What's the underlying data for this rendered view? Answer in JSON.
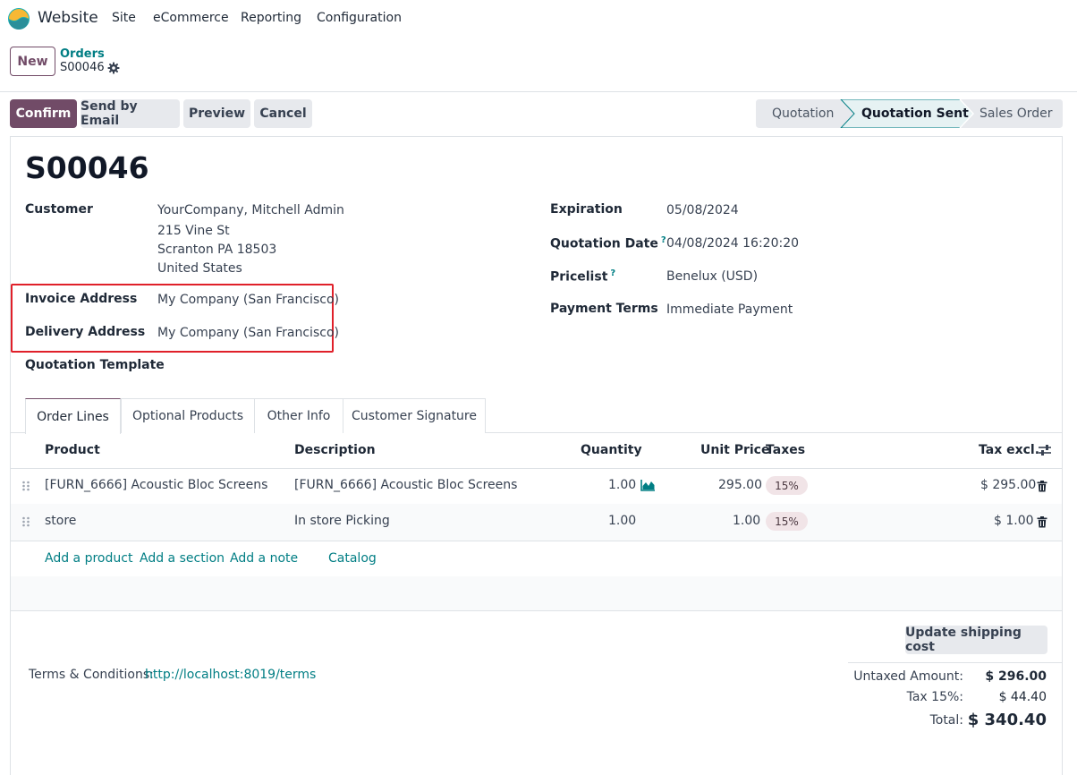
{
  "app": {
    "name": "Website",
    "menu": [
      "Site",
      "eCommerce",
      "Reporting",
      "Configuration"
    ]
  },
  "control": {
    "new_label": "New",
    "breadcrumb_parent": "Orders",
    "breadcrumb_current": "S00046"
  },
  "actions": {
    "confirm": "Confirm",
    "send_email": "Send by Email",
    "preview": "Preview",
    "cancel": "Cancel"
  },
  "status": {
    "steps": [
      "Quotation",
      "Quotation Sent",
      "Sales Order"
    ],
    "active": "Quotation Sent"
  },
  "form": {
    "name": "S00046",
    "customer_label": "Customer",
    "customer_lines": [
      "YourCompany, Mitchell Admin",
      "215 Vine St",
      "Scranton PA 18503",
      "United States"
    ],
    "invoice_label": "Invoice Address",
    "invoice_value": "My Company (San Francisco)",
    "delivery_label": "Delivery Address",
    "delivery_value": "My Company (San Francisco)",
    "template_label": "Quotation Template",
    "expiration_label": "Expiration",
    "expiration_value": "05/08/2024",
    "qdate_label": "Quotation Date",
    "qdate_value": "04/08/2024 16:20:20",
    "pricelist_label": "Pricelist",
    "pricelist_value": "Benelux (USD)",
    "terms_label": "Payment Terms",
    "terms_value": "Immediate Payment",
    "help_mark": "?"
  },
  "tabs": [
    "Order Lines",
    "Optional Products",
    "Other Info",
    "Customer Signature"
  ],
  "table": {
    "headers": {
      "product": "Product",
      "description": "Description",
      "quantity": "Quantity",
      "unit_price": "Unit Price",
      "taxes": "Taxes",
      "tax_excl": "Tax excl."
    },
    "rows": [
      {
        "product": "[FURN_6666] Acoustic Bloc Screens",
        "description": "[FURN_6666] Acoustic Bloc Screens",
        "quantity": "1.00",
        "unit_price": "295.00",
        "tax": "15%",
        "subtotal": "$ 295.00"
      },
      {
        "product": "store",
        "description": "In store Picking",
        "quantity": "1.00",
        "unit_price": "1.00",
        "tax": "15%",
        "subtotal": "$ 1.00"
      }
    ],
    "add_links": [
      "Add a product",
      "Add a section",
      "Add a note",
      "Catalog"
    ]
  },
  "footer": {
    "terms_label": "Terms & Conditions:",
    "terms_link": "http://localhost:8019/terms",
    "shipping_button": "Update shipping cost",
    "untaxed_label": "Untaxed Amount:",
    "untaxed_value": "$ 296.00",
    "tax_label": "Tax 15%:",
    "tax_value": "$ 44.40",
    "total_label": "Total:",
    "total_value": "$ 340.40"
  },
  "colors": {
    "brand": "#714b67",
    "link": "#017e84",
    "highlight": "#e0202a"
  }
}
